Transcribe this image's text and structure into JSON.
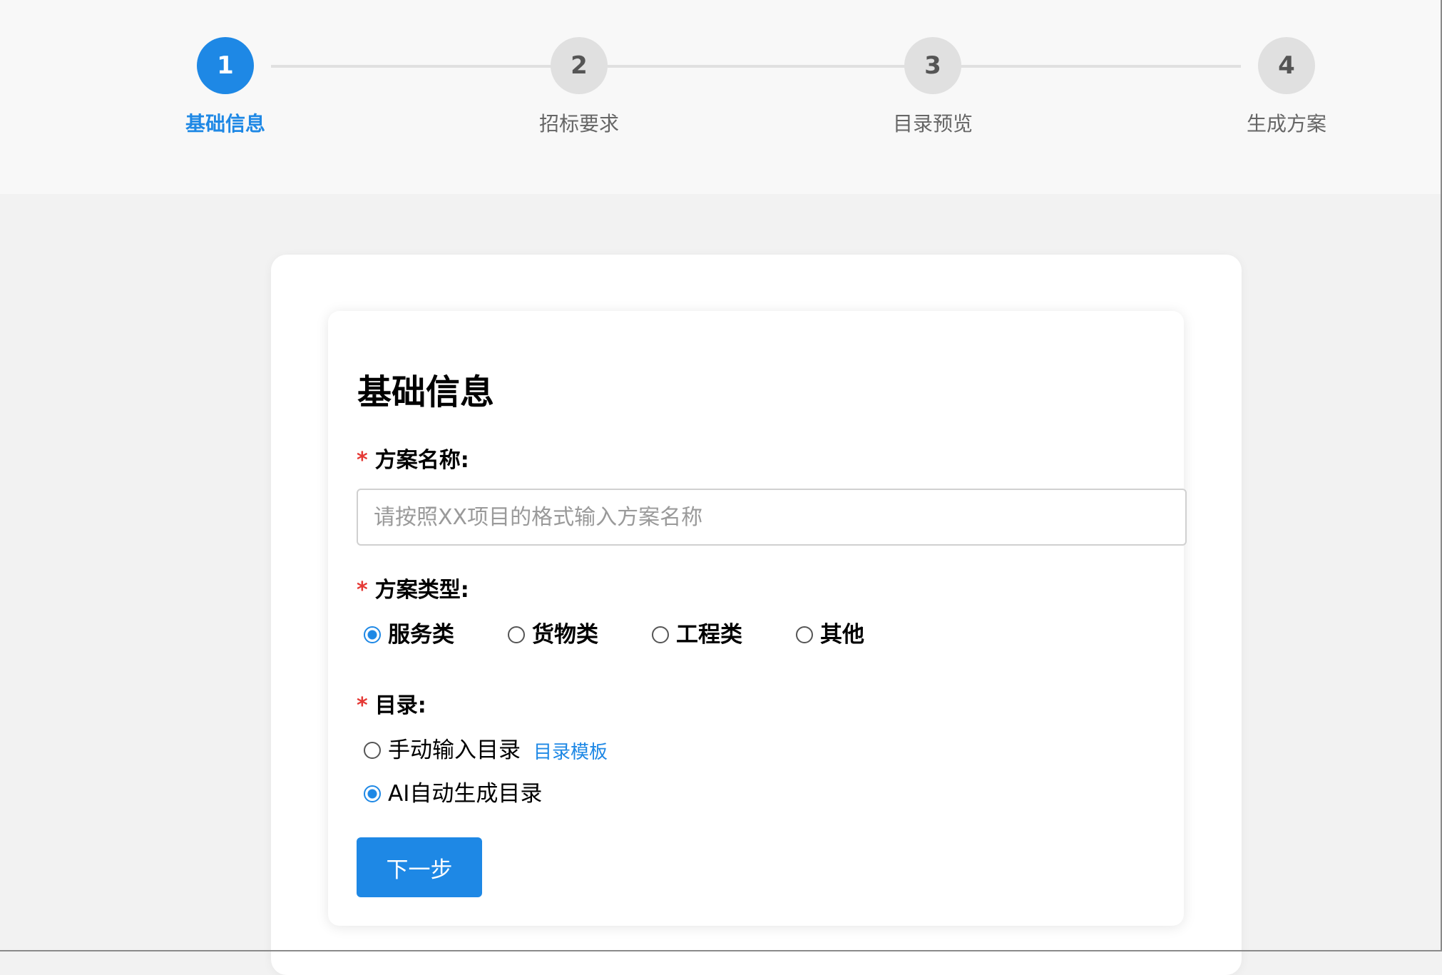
{
  "colors": {
    "accent": "#1e88e5",
    "inactive_step": "#e0e0e0",
    "required": "#e53935"
  },
  "stepper": {
    "steps": [
      {
        "number": "1",
        "label": "基础信息",
        "active": true
      },
      {
        "number": "2",
        "label": "招标要求",
        "active": false
      },
      {
        "number": "3",
        "label": "目录预览",
        "active": false
      },
      {
        "number": "4",
        "label": "生成方案",
        "active": false
      }
    ]
  },
  "form": {
    "title": "基础信息",
    "required_mark": "*",
    "name_field": {
      "label": "方案名称:",
      "value": "",
      "placeholder": "请按照XX项目的格式输入方案名称"
    },
    "type_field": {
      "label": "方案类型:",
      "options": [
        "服务类",
        "货物类",
        "工程类",
        "其他"
      ],
      "selected": "服务类"
    },
    "catalog_field": {
      "label": "目录:",
      "manual_option": "手动输入目录",
      "template_link": "目录模板",
      "ai_option": "AI自动生成目录",
      "selected": "AI自动生成目录"
    },
    "next_button": "下一步"
  }
}
